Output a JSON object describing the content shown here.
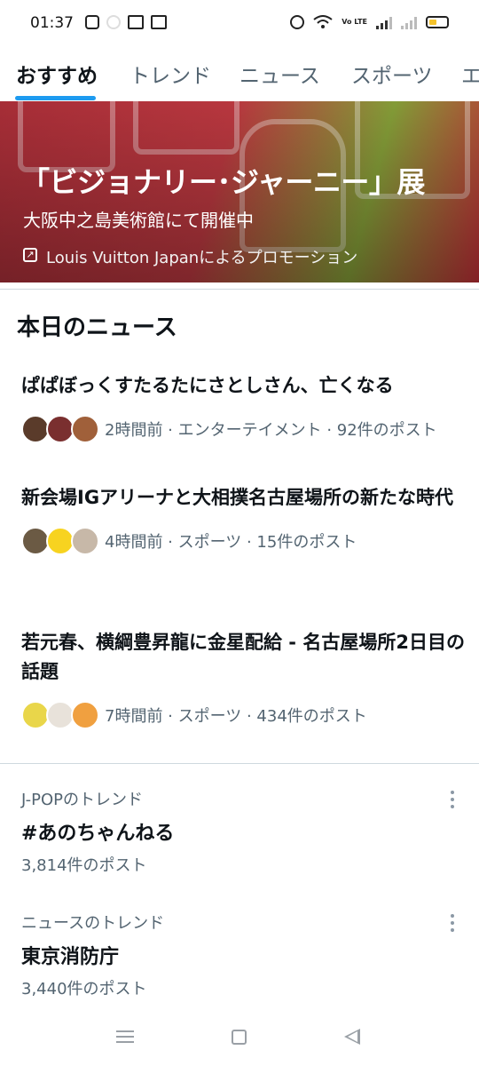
{
  "status_bar": {
    "time": "01:37",
    "left_icons": [
      "instagram-icon",
      "app-icon",
      "news-icon",
      "calendar-icon"
    ],
    "right_icons": [
      "alarm-icon",
      "wifi-icon",
      "volte-icon",
      "signal-icon",
      "signal-icon-2",
      "battery-icon"
    ],
    "volte_label": "Vo LTE",
    "battery_color": "#f4c22b"
  },
  "tabs": [
    {
      "label": "おすすめ",
      "active": true
    },
    {
      "label": "トレンド",
      "active": false
    },
    {
      "label": "ニュース",
      "active": false
    },
    {
      "label": "スポーツ",
      "active": false
    },
    {
      "label": "エ",
      "active": false
    }
  ],
  "accent_color": "#1d9bf0",
  "promo": {
    "title": "「ビジョナリー･ジャーニー」展",
    "subtitle": "大阪中之島美術館にて開催中",
    "sponsor": "Louis Vuitton Japanによるプロモーション",
    "sponsor_icon": "promoted-arrow-icon"
  },
  "news_section": {
    "title": "本日のニュース",
    "items": [
      {
        "headline": "ぱぱぼっくすたるたにさとしさん、亡くなる",
        "meta": "2時間前 · エンターテイメント · 92件のポスト",
        "avatar_colors": [
          "#5a3b2a",
          "#7a2f2f",
          "#a0603a"
        ]
      },
      {
        "headline": "新会場IGアリーナと大相撲名古屋場所の新たな時代",
        "meta": "4時間前 · スポーツ · 15件のポスト",
        "avatar_colors": [
          "#6b5a44",
          "#f7d320",
          "#c7b8a8"
        ]
      },
      {
        "headline": "若元春、横綱豊昇龍に金星配給 - 名古屋場所2日目の話題",
        "meta": "7時間前 · スポーツ · 434件のポスト",
        "avatar_colors": [
          "#e9d64a",
          "#e8e2da",
          "#f0a040"
        ]
      }
    ]
  },
  "trends": [
    {
      "category": "J-POPのトレンド",
      "name": "#あのちゃんねる",
      "count": "3,814件のポスト"
    },
    {
      "category": "ニュースのトレンド",
      "name": "東京消防庁",
      "count": "3,440件のポスト"
    }
  ],
  "navbar": {
    "icons": [
      "menu-icon",
      "home-square-icon",
      "back-triangle-icon"
    ]
  }
}
